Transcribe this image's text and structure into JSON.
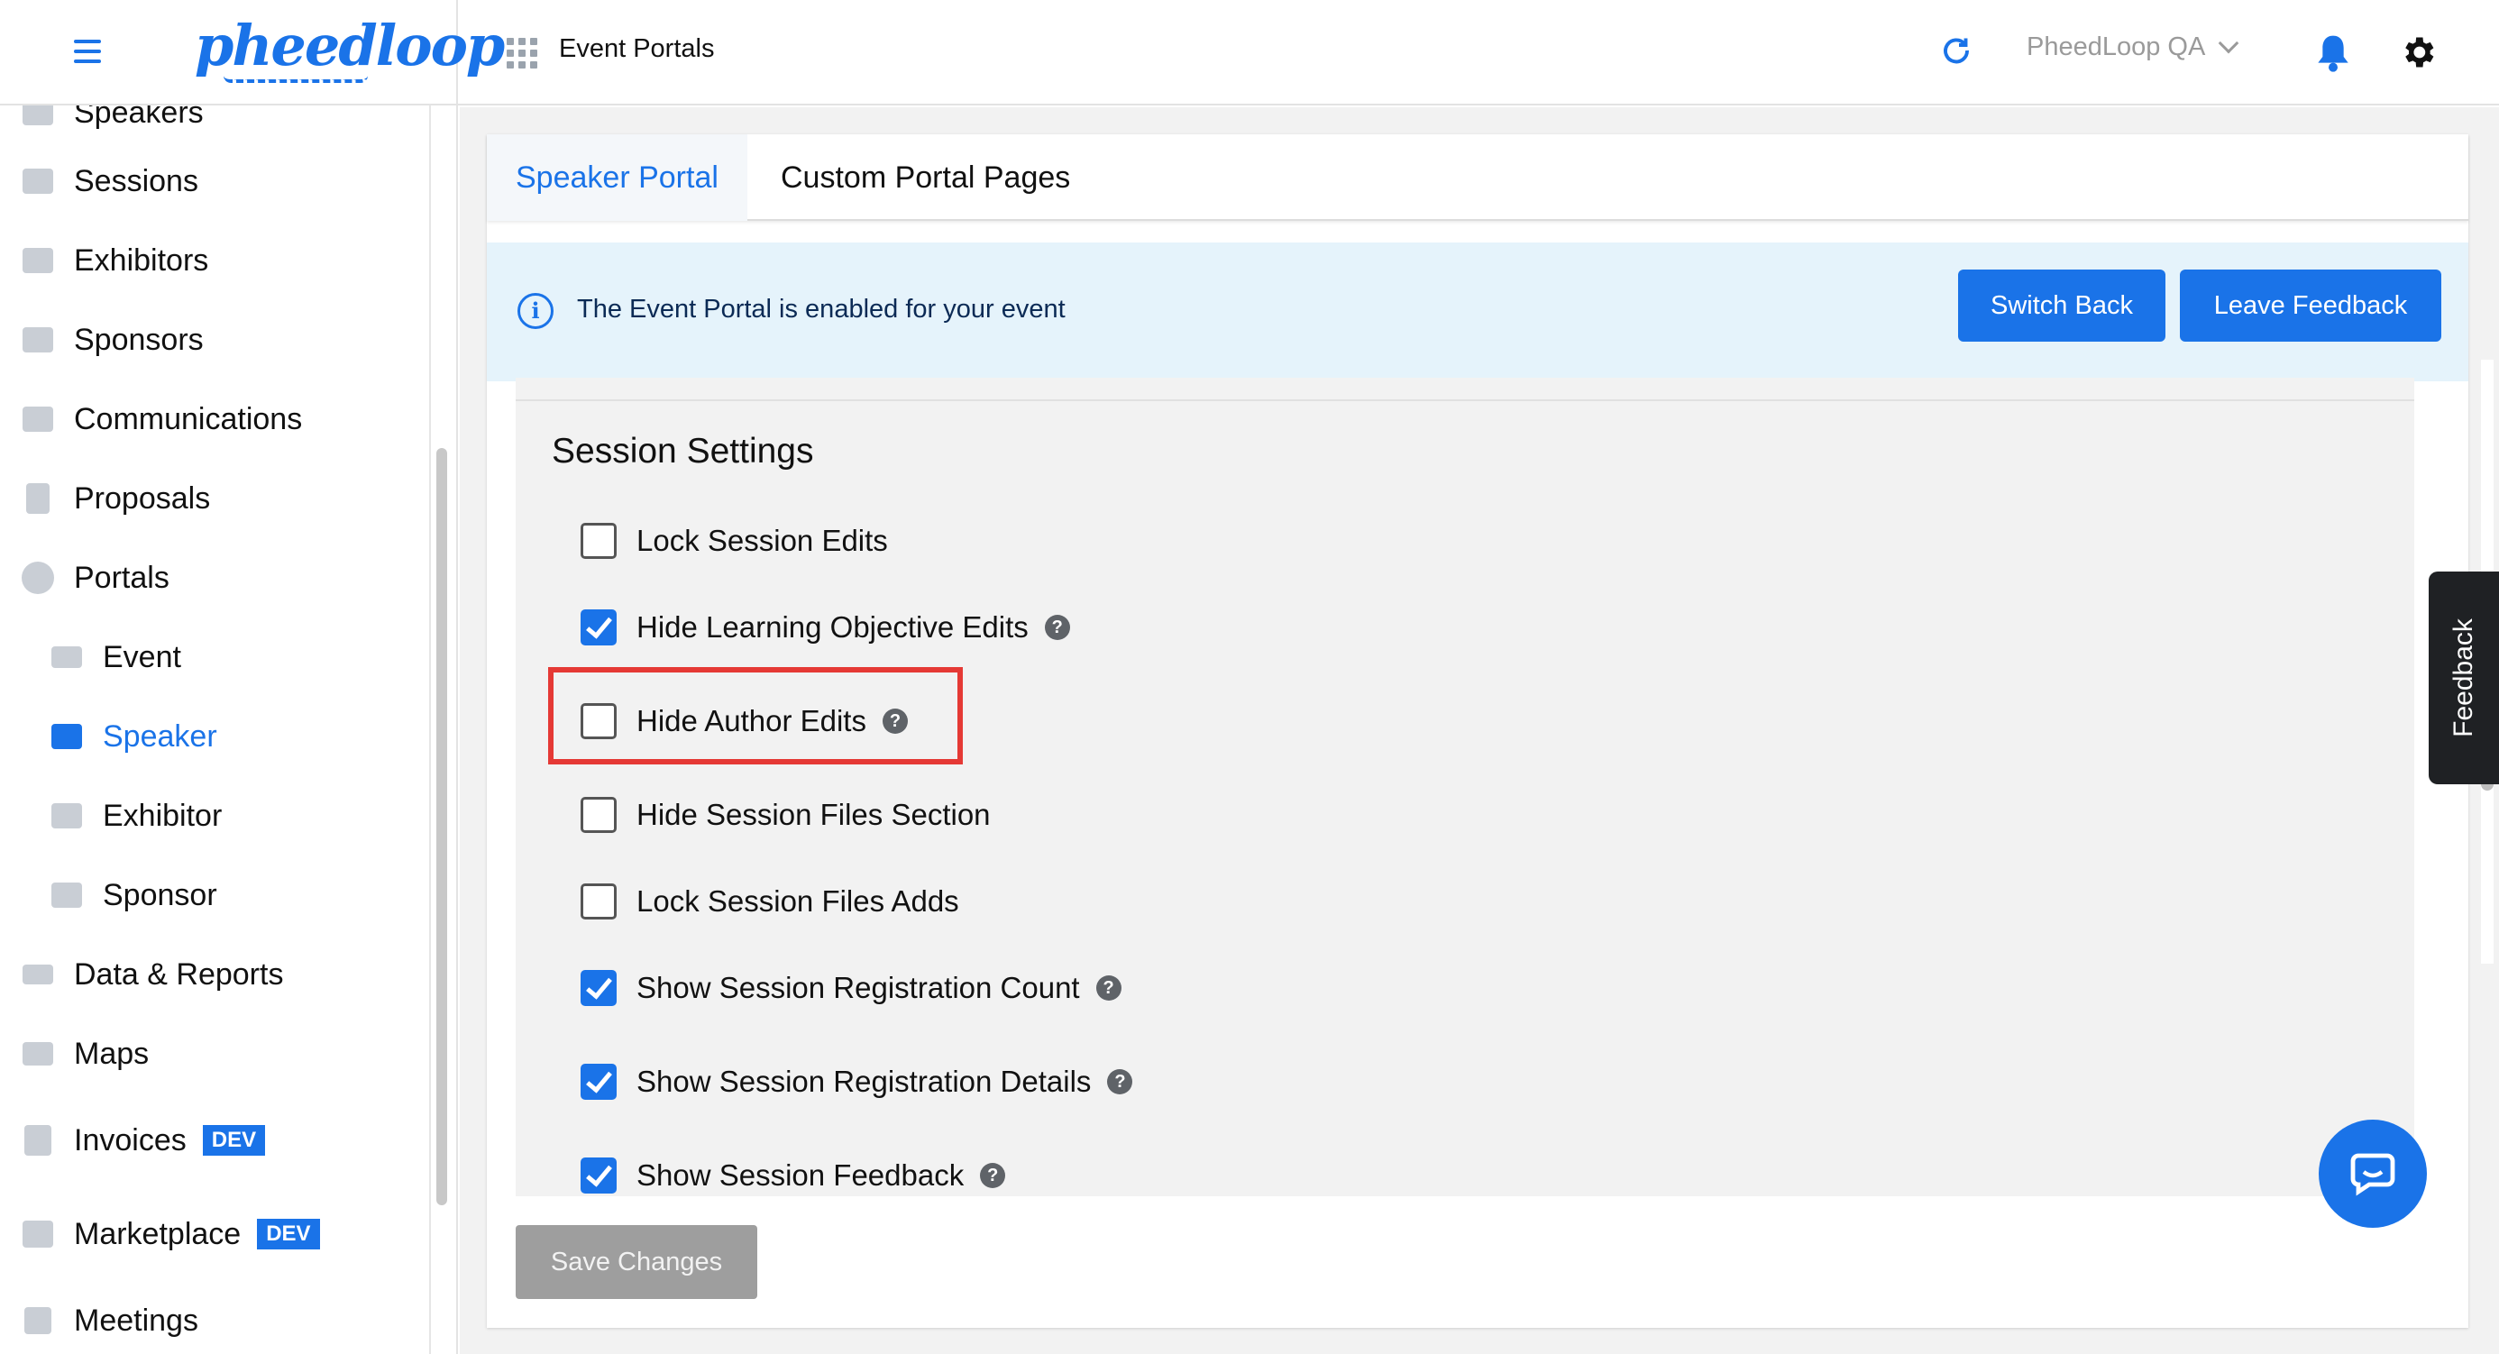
{
  "header": {
    "logo_text": "pheedloop",
    "page_title": "Event Portals",
    "org_name": "PheedLoop QA"
  },
  "sidebar": {
    "top_partial_label": "Speakers",
    "items": [
      {
        "label": "Sessions",
        "icon": "monitor-icon"
      },
      {
        "label": "Exhibitors",
        "icon": "storefront-icon"
      },
      {
        "label": "Sponsors",
        "icon": "badge-icon"
      },
      {
        "label": "Communications",
        "icon": "envelope-icon"
      },
      {
        "label": "Proposals",
        "icon": "document-icon"
      },
      {
        "label": "Portals",
        "icon": "globe-icon"
      },
      {
        "label": "Event",
        "icon": "video-icon",
        "sub": true
      },
      {
        "label": "Speaker",
        "icon": "presenter-icon",
        "sub": true,
        "active": true
      },
      {
        "label": "Exhibitor",
        "icon": "storefront-icon",
        "sub": true
      },
      {
        "label": "Sponsor",
        "icon": "badge-icon",
        "sub": true
      },
      {
        "label": "Data & Reports",
        "icon": "chart-icon"
      },
      {
        "label": "Maps",
        "icon": "map-icon"
      },
      {
        "label": "Invoices",
        "icon": "invoice-icon",
        "badge": "DEV"
      },
      {
        "label": "Marketplace",
        "icon": "cart-icon",
        "badge": "DEV"
      },
      {
        "label": "Meetings",
        "icon": "calendar-icon"
      }
    ]
  },
  "tabs": [
    {
      "label": "Speaker Portal",
      "active": true
    },
    {
      "label": "Custom Portal Pages",
      "active": false
    }
  ],
  "info_bar": {
    "message": "The Event Portal is enabled for your event",
    "switch_back_label": "Switch Back",
    "leave_feedback_label": "Leave Feedback"
  },
  "session_settings": {
    "title": "Session Settings",
    "options": [
      {
        "label": "Lock Session Edits",
        "checked": false,
        "help": false
      },
      {
        "label": "Hide Learning Objective Edits",
        "checked": true,
        "help": true
      },
      {
        "label": "Hide Author Edits",
        "checked": false,
        "help": true,
        "highlighted": true
      },
      {
        "label": "Hide Session Files Section",
        "checked": false,
        "help": false
      },
      {
        "label": "Lock Session Files Adds",
        "checked": false,
        "help": false
      },
      {
        "label": "Show Session Registration Count",
        "checked": true,
        "help": true
      },
      {
        "label": "Show Session Registration Details",
        "checked": true,
        "help": true
      },
      {
        "label": "Show Session Feedback",
        "checked": true,
        "help": true
      }
    ]
  },
  "save_label": "Save Changes",
  "feedback_tab_label": "Feedback",
  "colors": {
    "accent": "#1a73e8",
    "highlight": "#e53935",
    "info_bg": "#e5f3fb"
  }
}
